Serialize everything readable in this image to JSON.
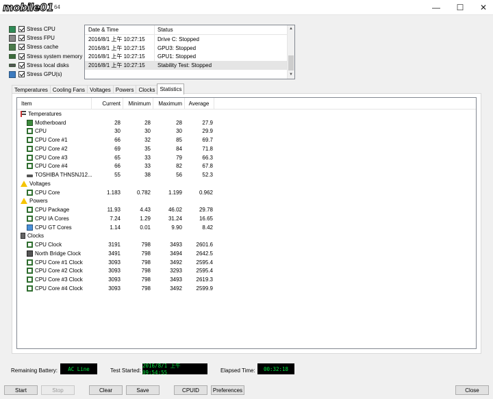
{
  "window": {
    "logo": "mobile01",
    "logo_suffix": "64",
    "controls": {
      "minimize": "—",
      "maximize": "☐",
      "close": "✕"
    }
  },
  "stress_options": [
    {
      "label": "Stress CPU",
      "checked": true,
      "icon": "cpu-chip-icon"
    },
    {
      "label": "Stress FPU",
      "checked": true,
      "icon": "fpu-icon"
    },
    {
      "label": "Stress cache",
      "checked": true,
      "icon": "cache-icon"
    },
    {
      "label": "Stress system memory",
      "checked": true,
      "icon": "memory-icon"
    },
    {
      "label": "Stress local disks",
      "checked": true,
      "icon": "disk-icon"
    },
    {
      "label": "Stress GPU(s)",
      "checked": true,
      "icon": "gpu-monitor-icon"
    }
  ],
  "log": {
    "headers": {
      "datetime": "Date & Time",
      "status": "Status"
    },
    "rows": [
      {
        "datetime": "2016/8/1 上午 10:27:15",
        "status": "Drive C: Stopped"
      },
      {
        "datetime": "2016/8/1 上午 10:27:15",
        "status": "GPU3: Stopped"
      },
      {
        "datetime": "2016/8/1 上午 10:27:15",
        "status": "GPU1: Stopped"
      },
      {
        "datetime": "2016/8/1 上午 10:27:15",
        "status": "Stability Test: Stopped"
      }
    ]
  },
  "tabs": [
    {
      "label": "Temperatures",
      "active": false
    },
    {
      "label": "Cooling Fans",
      "active": false
    },
    {
      "label": "Voltages",
      "active": false
    },
    {
      "label": "Powers",
      "active": false
    },
    {
      "label": "Clocks",
      "active": false
    },
    {
      "label": "Statistics",
      "active": true
    }
  ],
  "stats": {
    "headers": {
      "item": "Item",
      "current": "Current",
      "minimum": "Minimum",
      "maximum": "Maximum",
      "average": "Average"
    },
    "rows": [
      {
        "kind": "group",
        "icon": "thermometer-icon",
        "item": "Temperatures"
      },
      {
        "kind": "leaf",
        "icon": "motherboard-icon",
        "item": "Motherboard",
        "current": "28",
        "minimum": "28",
        "maximum": "28",
        "average": "27.9"
      },
      {
        "kind": "leaf",
        "icon": "cpu-chip-icon",
        "item": "CPU",
        "current": "30",
        "minimum": "30",
        "maximum": "30",
        "average": "29.9"
      },
      {
        "kind": "leaf",
        "icon": "cpu-chip-icon",
        "item": "CPU Core #1",
        "current": "66",
        "minimum": "32",
        "maximum": "85",
        "average": "69.7"
      },
      {
        "kind": "leaf",
        "icon": "cpu-chip-icon",
        "item": "CPU Core #2",
        "current": "69",
        "minimum": "35",
        "maximum": "84",
        "average": "71.8"
      },
      {
        "kind": "leaf",
        "icon": "cpu-chip-icon",
        "item": "CPU Core #3",
        "current": "65",
        "minimum": "33",
        "maximum": "79",
        "average": "66.3"
      },
      {
        "kind": "leaf",
        "icon": "cpu-chip-icon",
        "item": "CPU Core #4",
        "current": "66",
        "minimum": "33",
        "maximum": "82",
        "average": "67.8"
      },
      {
        "kind": "leaf",
        "icon": "disk-icon",
        "item": "TOSHIBA THNSNJ12...",
        "current": "55",
        "minimum": "38",
        "maximum": "56",
        "average": "52.3"
      },
      {
        "kind": "group",
        "icon": "warning-icon",
        "item": "Voltages"
      },
      {
        "kind": "leaf",
        "icon": "cpu-chip-icon",
        "item": "CPU Core",
        "current": "1.183",
        "minimum": "0.782",
        "maximum": "1.199",
        "average": "0.962"
      },
      {
        "kind": "group",
        "icon": "warning-icon",
        "item": "Powers"
      },
      {
        "kind": "leaf",
        "icon": "cpu-chip-icon",
        "item": "CPU Package",
        "current": "11.93",
        "minimum": "4.43",
        "maximum": "46.02",
        "average": "29.78"
      },
      {
        "kind": "leaf",
        "icon": "cpu-chip-icon",
        "item": "CPU IA Cores",
        "current": "7.24",
        "minimum": "1.29",
        "maximum": "31.24",
        "average": "16.65"
      },
      {
        "kind": "leaf",
        "icon": "gpu-monitor-icon",
        "item": "CPU GT Cores",
        "current": "1.14",
        "minimum": "0.01",
        "maximum": "9.90",
        "average": "8.42"
      },
      {
        "kind": "group",
        "icon": "clock-icon",
        "item": "Clocks"
      },
      {
        "kind": "leaf",
        "icon": "cpu-chip-icon",
        "item": "CPU Clock",
        "current": "3191",
        "minimum": "798",
        "maximum": "3493",
        "average": "2601.6"
      },
      {
        "kind": "leaf",
        "icon": "north-bridge-icon",
        "item": "North Bridge Clock",
        "current": "3491",
        "minimum": "798",
        "maximum": "3494",
        "average": "2642.5"
      },
      {
        "kind": "leaf",
        "icon": "cpu-chip-icon",
        "item": "CPU Core #1 Clock",
        "current": "3093",
        "minimum": "798",
        "maximum": "3492",
        "average": "2595.4"
      },
      {
        "kind": "leaf",
        "icon": "cpu-chip-icon",
        "item": "CPU Core #2 Clock",
        "current": "3093",
        "minimum": "798",
        "maximum": "3293",
        "average": "2595.4"
      },
      {
        "kind": "leaf",
        "icon": "cpu-chip-icon",
        "item": "CPU Core #3 Clock",
        "current": "3093",
        "minimum": "798",
        "maximum": "3493",
        "average": "2619.3"
      },
      {
        "kind": "leaf",
        "icon": "cpu-chip-icon",
        "item": "CPU Core #4 Clock",
        "current": "3093",
        "minimum": "798",
        "maximum": "3492",
        "average": "2599.9"
      }
    ]
  },
  "status_bar": {
    "battery_label": "Remaining Battery:",
    "battery_value": "AC Line",
    "started_label": "Test Started:",
    "started_value": "2016/8/1 上午 09:54:55",
    "elapsed_label": "Elapsed Time:",
    "elapsed_value": "00:32:18",
    "value_color": "#00e640"
  },
  "buttons": {
    "start": "Start",
    "stop": "Stop",
    "clear": "Clear",
    "save": "Save",
    "cpuid": "CPUID",
    "preferences": "Preferences",
    "close": "Close"
  }
}
